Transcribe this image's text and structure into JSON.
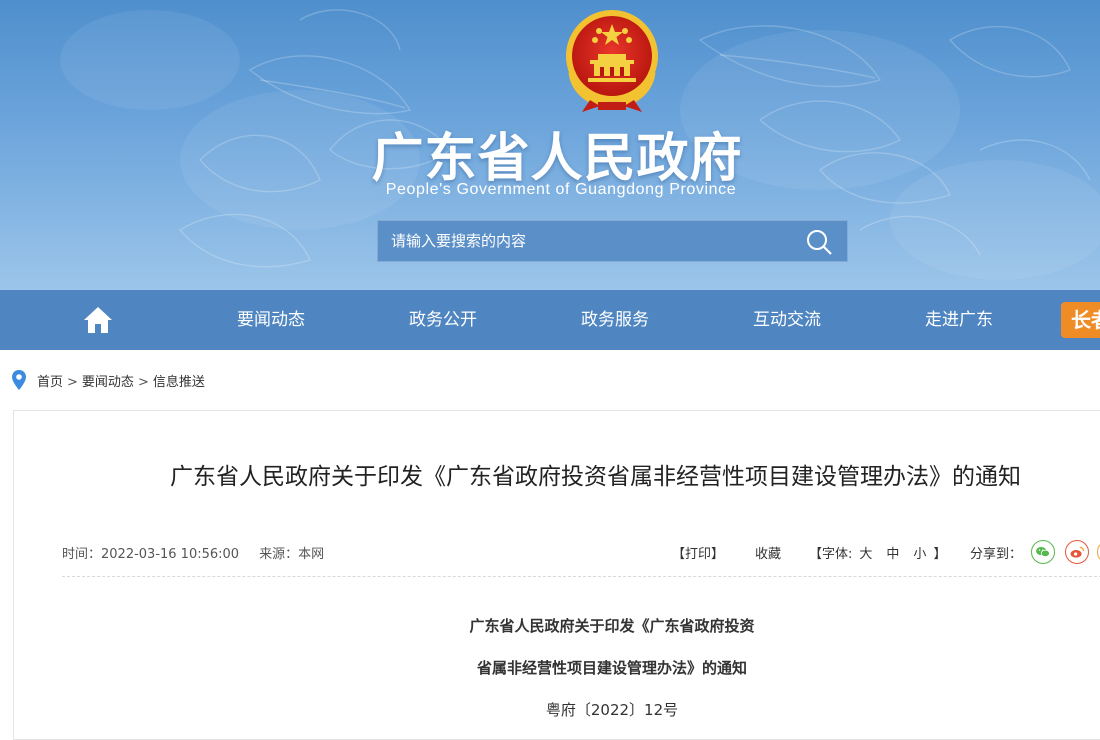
{
  "header": {
    "title": "广东省人民政府",
    "subtitle": "People's Government of Guangdong Province",
    "emblem_icon": "national-emblem-icon",
    "search": {
      "placeholder": "请输入要搜索的内容",
      "icon": "search-icon"
    }
  },
  "nav": {
    "home_icon": "home-icon",
    "items": [
      {
        "label": "要闻动态"
      },
      {
        "label": "政务公开"
      },
      {
        "label": "政务服务"
      },
      {
        "label": "互动交流"
      },
      {
        "label": "走进广东"
      }
    ],
    "badge": "长者"
  },
  "breadcrumb": {
    "icon": "location-pin-icon",
    "items": [
      "首页",
      "要闻动态",
      "信息推送"
    ],
    "separator": ">"
  },
  "article": {
    "title": "广东省人民政府关于印发《广东省政府投资省属非经营性项目建设管理办法》的通知",
    "time": "时间：2022-03-16 10:56:00",
    "source": "来源：本网",
    "print": "【打印】",
    "favorite": "收藏",
    "font_label": "【字体:",
    "font_sizes": [
      "大",
      "中",
      "小"
    ],
    "font_close": "】",
    "share_label": "分享到：",
    "doc_heading_line1": "广东省人民政府关于印发《广东省政府投资",
    "doc_heading_line2": "省属非经营性项目建设管理办法》的通知",
    "doc_number": "粤府〔2022〕12号"
  },
  "colors": {
    "nav_bg": "#4f86c1",
    "badge_bg": "#f08c26",
    "wechat": "#52b94a",
    "weibo": "#e6553a",
    "pin": "#3b8be0"
  }
}
